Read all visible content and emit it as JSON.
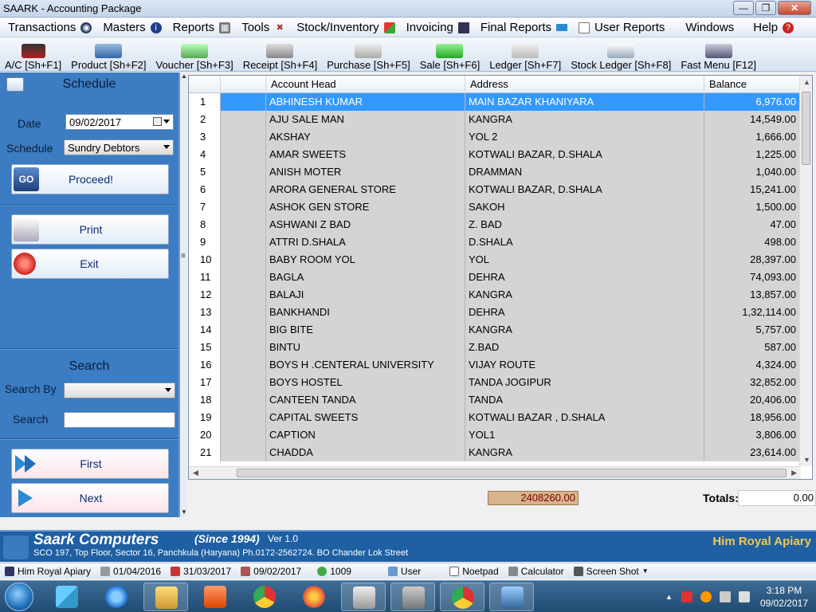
{
  "window": {
    "title": "SAARK - Accounting Package"
  },
  "menubar": [
    {
      "label": "Transactions",
      "icon": "disk-icon"
    },
    {
      "label": "Masters",
      "icon": "info-icon"
    },
    {
      "label": "Reports",
      "icon": "calculator-icon"
    },
    {
      "label": "Tools",
      "icon": "tools-icon"
    },
    {
      "label": "Stock/Inventory",
      "icon": "blocks-icon"
    },
    {
      "label": "Invoicing",
      "icon": "monitor-icon"
    },
    {
      "label": "Final Reports",
      "icon": "keyboard-icon"
    },
    {
      "label": "User Reports",
      "icon": "document-icon"
    },
    {
      "label": "Windows",
      "icon": ""
    },
    {
      "label": "Help",
      "icon": "help-icon"
    }
  ],
  "toolbar": [
    {
      "label": "A/C [Sh+F1]",
      "icon": "ledger-book-icon"
    },
    {
      "label": "Product [Sh+F2]",
      "icon": "product-icon"
    },
    {
      "label": "Voucher [Sh+F3]",
      "icon": "voucher-icon"
    },
    {
      "label": "Receipt [Sh+F4]",
      "icon": "receipt-icon"
    },
    {
      "label": "Purchase [Sh+F5]",
      "icon": "purchase-icon"
    },
    {
      "label": "Sale [Sh+F6]",
      "icon": "sale-icon"
    },
    {
      "label": "Ledger [Sh+F7]",
      "icon": "ledger-icon"
    },
    {
      "label": "Stock Ledger [Sh+F8]",
      "icon": "stock-ledger-icon"
    },
    {
      "label": "Fast Menu [F12]",
      "icon": "fast-menu-icon"
    }
  ],
  "schedule": {
    "title": "Schedule",
    "date_label": "Date",
    "date_value": "09/02/2017",
    "schedule_label": "Schedule",
    "schedule_value": "Sundry Debtors",
    "proceed_label": "Proceed!",
    "print_label": "Print",
    "exit_label": "Exit"
  },
  "search": {
    "title": "Search",
    "search_by_label": "Search By",
    "search_by_value": "",
    "search_label": "Search",
    "search_value": "",
    "first_label": "First",
    "next_label": "Next"
  },
  "grid": {
    "columns": [
      "Account Head",
      "Address",
      "Balance"
    ],
    "rows": [
      {
        "n": "1",
        "name": "ABHINESH KUMAR",
        "addr": "MAIN BAZAR KHANIYARA",
        "bal": "6,976.00"
      },
      {
        "n": "2",
        "name": "AJU SALE MAN",
        "addr": "KANGRA",
        "bal": "14,549.00"
      },
      {
        "n": "3",
        "name": "AKSHAY",
        "addr": "YOL 2",
        "bal": "1,666.00"
      },
      {
        "n": "4",
        "name": "AMAR SWEETS",
        "addr": "KOTWALI BAZAR, D.SHALA",
        "bal": "1,225.00"
      },
      {
        "n": "5",
        "name": "ANISH MOTER",
        "addr": "DRAMMAN",
        "bal": "1,040.00"
      },
      {
        "n": "6",
        "name": "ARORA GENERAL STORE",
        "addr": "KOTWALI BAZAR, D.SHALA",
        "bal": "15,241.00"
      },
      {
        "n": "7",
        "name": "ASHOK GEN STORE",
        "addr": "SAKOH",
        "bal": "1,500.00"
      },
      {
        "n": "8",
        "name": "ASHWANI Z BAD",
        "addr": "Z. BAD",
        "bal": "47.00"
      },
      {
        "n": "9",
        "name": "ATTRI D.SHALA",
        "addr": "D.SHALA",
        "bal": "498.00"
      },
      {
        "n": "10",
        "name": "BABY ROOM YOL",
        "addr": "YOL",
        "bal": "28,397.00"
      },
      {
        "n": "11",
        "name": "BAGLA",
        "addr": "DEHRA",
        "bal": "74,093.00"
      },
      {
        "n": "12",
        "name": "BALAJI",
        "addr": "KANGRA",
        "bal": "13,857.00"
      },
      {
        "n": "13",
        "name": "BANKHANDI",
        "addr": "DEHRA",
        "bal": "1,32,114.00"
      },
      {
        "n": "14",
        "name": "BIG BITE",
        "addr": "KANGRA",
        "bal": "5,757.00"
      },
      {
        "n": "15",
        "name": "BINTU",
        "addr": "Z.BAD",
        "bal": "587.00"
      },
      {
        "n": "16",
        "name": "BOYS H .CENTERAL UNIVERSITY",
        "addr": "VIJAY ROUTE",
        "bal": "4,324.00"
      },
      {
        "n": "17",
        "name": "BOYS HOSTEL",
        "addr": "TANDA JOGIPUR",
        "bal": "32,852.00"
      },
      {
        "n": "18",
        "name": "CANTEEN TANDA",
        "addr": "TANDA",
        "bal": "20,406.00"
      },
      {
        "n": "19",
        "name": "CAPITAL SWEETS",
        "addr": "KOTWALI BAZAR , D.SHALA",
        "bal": "18,956.00"
      },
      {
        "n": "20",
        "name": "CAPTION",
        "addr": "YOL1",
        "bal": "3,806.00"
      },
      {
        "n": "21",
        "name": "CHADDA",
        "addr": "KANGRA",
        "bal": "23,614.00"
      }
    ],
    "selected_index": 0
  },
  "totals": {
    "sum_value": "2408260.00",
    "label": "Totals:",
    "value": "0.00"
  },
  "banner": {
    "company": "Saark Computers",
    "since": "(Since 1994)",
    "version": "Ver 1.0",
    "address": "SCO 197, Top Floor, Sector 16, Panchkula (Haryana) Ph.0172-2562724.  BO Chander Lok Street",
    "client": "Him Royal Apiary"
  },
  "statusbar": {
    "company": "Him Royal Apiary",
    "fy_start": "01/04/2016",
    "fy_end": "31/03/2017",
    "current_date": "09/02/2017",
    "code": "1009",
    "user": "User",
    "notepad": "Noetpad",
    "calculator": "Calculator",
    "screenshot": "Screen Shot"
  },
  "taskbar": {
    "time": "3:18 PM",
    "date": "09/02/2017"
  },
  "colors": {
    "panel_blue": "#3b7cc2",
    "selection": "#3399ff",
    "banner_blue": "#1f5fa3",
    "client_gold": "#f2c94c"
  }
}
